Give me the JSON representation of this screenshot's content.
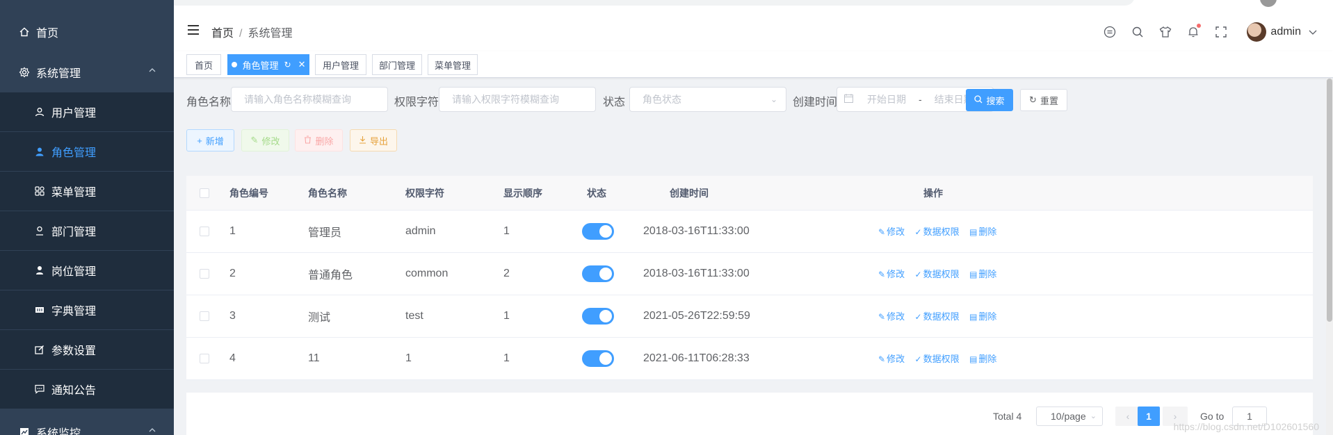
{
  "sidebar": {
    "home": "首页",
    "system": "系统管理",
    "items": [
      {
        "label": "用户管理",
        "icon": "user-icon"
      },
      {
        "label": "角色管理",
        "icon": "role-icon"
      },
      {
        "label": "菜单管理",
        "icon": "menu-icon"
      },
      {
        "label": "部门管理",
        "icon": "dept-icon"
      },
      {
        "label": "岗位管理",
        "icon": "post-icon"
      },
      {
        "label": "字典管理",
        "icon": "dict-icon"
      },
      {
        "label": "参数设置",
        "icon": "edit-icon"
      },
      {
        "label": "通知公告",
        "icon": "message-icon"
      }
    ],
    "monitor": "系统监控"
  },
  "navbar": {
    "breadcrumb": [
      "首页",
      "系统管理"
    ],
    "username": "admin"
  },
  "tags": [
    "首页",
    "角色管理",
    "用户管理",
    "部门管理",
    "菜单管理"
  ],
  "search": {
    "role_name_label": "角色名称",
    "role_name_placeholder": "请输入角色名称模糊查询",
    "perm_label": "权限字符",
    "perm_placeholder": "请输入权限字符模糊查询",
    "status_label": "状态",
    "status_placeholder": "角色状态",
    "created_label": "创建时间",
    "start_placeholder": "开始日期",
    "range_sep": "-",
    "end_placeholder": "结束日期",
    "search_btn": "搜索",
    "reset_btn": "重置"
  },
  "toolbar": {
    "add": "新增",
    "edit": "修改",
    "delete": "删除",
    "export": "导出"
  },
  "table": {
    "columns": [
      "角色编号",
      "角色名称",
      "权限字符",
      "显示顺序",
      "状态",
      "创建时间",
      "操作"
    ],
    "rows": [
      {
        "id": "1",
        "name": "管理员",
        "key": "admin",
        "sort": "1",
        "status": true,
        "created": "2018-03-16T11:33:00"
      },
      {
        "id": "2",
        "name": "普通角色",
        "key": "common",
        "sort": "2",
        "status": true,
        "created": "2018-03-16T11:33:00"
      },
      {
        "id": "3",
        "name": "测试",
        "key": "test",
        "sort": "1",
        "status": true,
        "created": "2021-05-26T22:59:59"
      },
      {
        "id": "4",
        "name": "11",
        "key": "1",
        "sort": "1",
        "status": true,
        "created": "2021-06-11T06:28:33"
      }
    ],
    "actions": {
      "edit": "修改",
      "data_scope": "数据权限",
      "delete": "删除"
    }
  },
  "pagination": {
    "total": "Total 4",
    "page_size": "10/page",
    "current": "1",
    "goto_label": "Go to",
    "goto_value": "1"
  },
  "watermark": "https://blog.csdn.net/D102601560",
  "colors": {
    "primary": "#409eff",
    "sidebar": "#304156",
    "submenu": "#1f2d3d"
  }
}
